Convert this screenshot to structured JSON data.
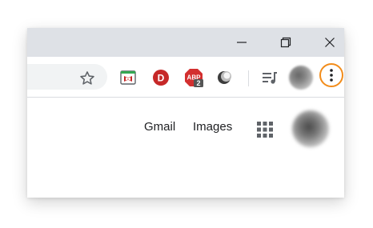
{
  "window_controls": {
    "minimize_icon": "minimize-icon",
    "maximize_icon": "restore-icon",
    "close_icon": "close-icon"
  },
  "toolbar": {
    "bookmark_icon": "star-icon",
    "extensions": [
      {
        "name": "mcafee-webadvisor-icon"
      },
      {
        "name": "d-extension-icon",
        "letter": "D"
      },
      {
        "name": "adblock-plus-icon",
        "label": "ABP",
        "badge": "2"
      },
      {
        "name": "dark-reader-icon"
      }
    ],
    "media_icon": "media-queue-icon",
    "menu_icon": "three-dot-menu-icon",
    "highlight_color": "#f28c1a"
  },
  "content": {
    "gmail_label": "Gmail",
    "images_label": "Images",
    "apps_icon": "apps-grid-icon"
  }
}
